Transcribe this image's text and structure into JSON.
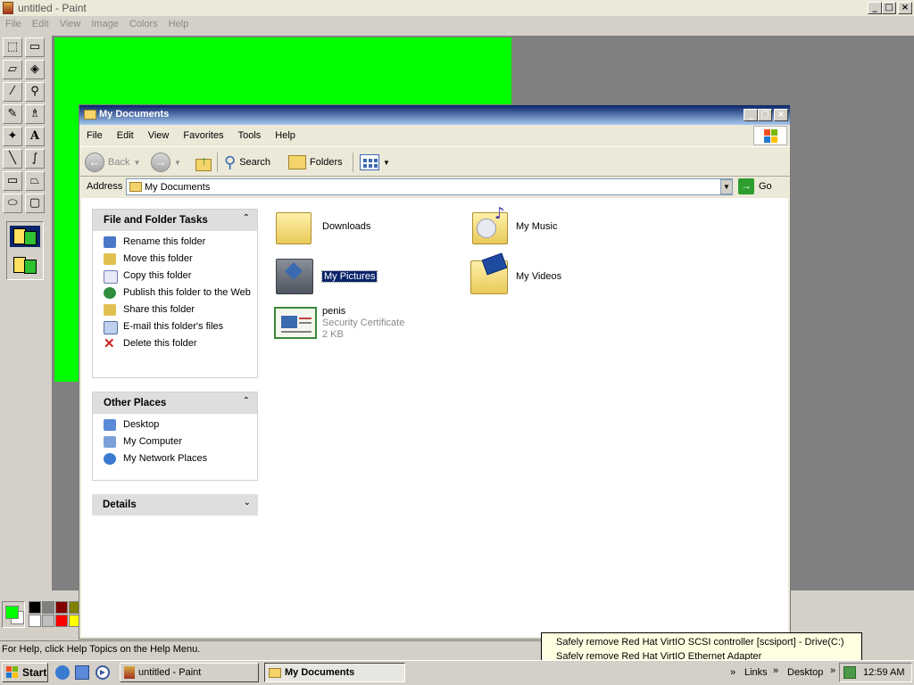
{
  "paint": {
    "title": "untitled - Paint",
    "menu": [
      "File",
      "Edit",
      "View",
      "Image",
      "Colors",
      "Help"
    ],
    "status": "For Help, click Help Topics on the Help Menu.",
    "canvas_color": "#00ff00",
    "palette": [
      "#000000",
      "#808080",
      "#800000",
      "#808000",
      "#ffffff",
      "#c0c0c0",
      "#ff0000",
      "#ffff00"
    ],
    "foreground": "#00ff00",
    "background": "#ffffff",
    "window_buttons": [
      "_",
      "□",
      "×"
    ]
  },
  "explorer": {
    "title": "My Documents",
    "menu": [
      "File",
      "Edit",
      "View",
      "Favorites",
      "Tools",
      "Help"
    ],
    "toolbar": {
      "back": "Back",
      "search": "Search",
      "folders": "Folders"
    },
    "address": {
      "label": "Address",
      "value": "My Documents",
      "go": "Go"
    },
    "panes": {
      "tasks": {
        "title": "File and Folder Tasks",
        "items": [
          "Rename this folder",
          "Move this folder",
          "Copy this folder",
          "Publish this folder to the Web",
          "Share this folder",
          "E-mail this folder's files",
          "Delete this folder"
        ]
      },
      "places": {
        "title": "Other Places",
        "items": [
          "Desktop",
          "My Computer",
          "My Network Places"
        ]
      },
      "details": {
        "title": "Details"
      }
    },
    "items": {
      "downloads": "Downloads",
      "my_music": "My Music",
      "my_pictures": "My Pictures",
      "my_videos": "My Videos",
      "cert_name": "penis",
      "cert_type": "Security Certificate",
      "cert_size": "2 KB"
    }
  },
  "balloon": {
    "line1": "Safely remove Red Hat VirtIO SCSI controller [scsiport] - Drive(C:)",
    "line2": "Safely remove Red Hat VirtIO Ethernet Adapter"
  },
  "taskbar": {
    "start": "Start",
    "tasks": [
      "untitled - Paint",
      "My Documents"
    ],
    "links": "Links",
    "desktop": "Desktop",
    "clock": "12:59 AM"
  }
}
